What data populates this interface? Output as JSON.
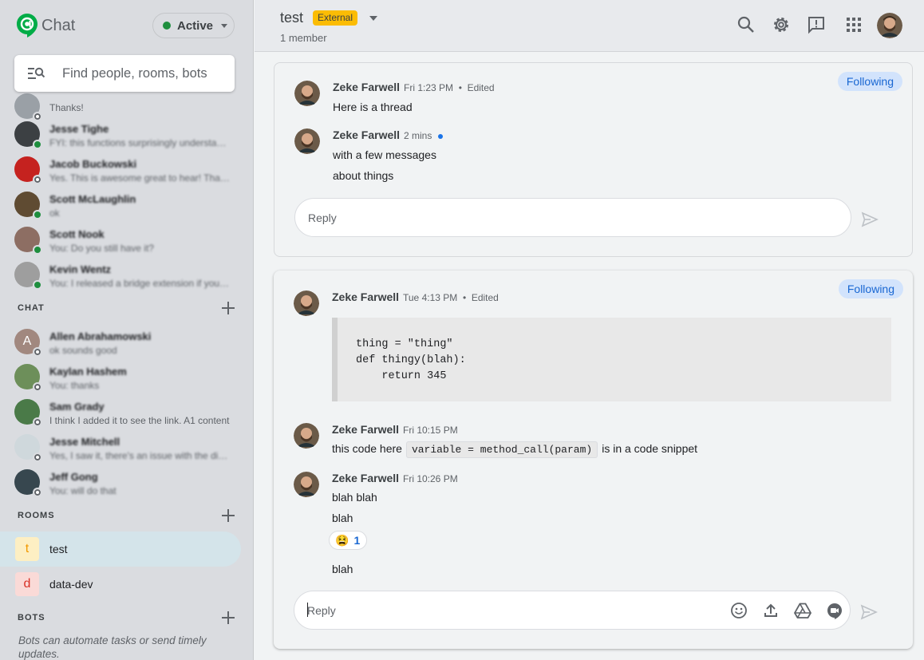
{
  "app": {
    "name": "Chat",
    "status": "Active"
  },
  "search": {
    "placeholder": "Find people, rooms, bots"
  },
  "dms": [
    {
      "name": "",
      "preview": "Thanks!",
      "online": false,
      "color": "#9aa0a6"
    },
    {
      "name": "Jesse Tighe",
      "preview": "FYI: this functions surprisingly understan...",
      "online": true,
      "color": "#3c4043"
    },
    {
      "name": "Jacob Buckowski",
      "preview": "Yes. This is awesome great to hear! Thank...",
      "online": false,
      "color": "#c5221f"
    },
    {
      "name": "Scott McLaughlin",
      "preview": "ok",
      "online": true,
      "color": "#5f4b32"
    },
    {
      "name": "Scott Nook",
      "preview": "You: Do you still have it?",
      "online": true,
      "color": "#8d6e63"
    },
    {
      "name": "Kevin Wentz",
      "preview": "You: I released a bridge extension if you wa...",
      "online": true,
      "color": "#9e9e9e"
    }
  ],
  "chat_section": {
    "title": "CHAT",
    "items": [
      {
        "name": "Allen Abrahamowski",
        "preview": "ok sounds good",
        "initial": "A",
        "color": "#a1887f"
      },
      {
        "name": "Kaylan Hashem",
        "preview": "You: thanks",
        "initial": "",
        "color": "#6d8f5a"
      },
      {
        "name": "Sam Grady",
        "preview": "I think I added it to see the link. A1 content",
        "initial": "",
        "color": "#4a7a48"
      },
      {
        "name": "Jesse Mitchell",
        "preview": "Yes, I saw it, there's an issue with the displa...",
        "initial": "",
        "color": "#cfd8dc"
      },
      {
        "name": "Jeff Gong",
        "preview": "You: will do that",
        "initial": "",
        "color": "#37474f"
      }
    ]
  },
  "rooms_section": {
    "title": "ROOMS",
    "items": [
      {
        "initial": "t",
        "name": "test",
        "active": true,
        "badge_bg": "#fdefc3",
        "badge_fg": "#f29900"
      },
      {
        "initial": "d",
        "name": "data-dev",
        "active": false,
        "badge_bg": "#fadad7",
        "badge_fg": "#d93025"
      }
    ]
  },
  "bots_section": {
    "title": "BOTS",
    "description": "Bots can automate tasks or send timely updates."
  },
  "header": {
    "title": "test",
    "badge": "External",
    "members": "1 member",
    "icons": [
      "search-icon",
      "settings-icon",
      "feedback-icon",
      "apps-icon"
    ]
  },
  "threads": [
    {
      "following": "Following",
      "messages": [
        {
          "author": "Zeke Farwell",
          "time": "Fri 1:23 PM",
          "edited": "Edited",
          "lines": [
            "Here is a thread"
          ]
        },
        {
          "author": "Zeke Farwell",
          "time": "2 mins",
          "edited": "",
          "lines": [
            "with a few messages",
            "about things"
          ]
        }
      ],
      "reply_placeholder": "Reply"
    },
    {
      "following": "Following",
      "messages": [
        {
          "author": "Zeke Farwell",
          "time": "Tue 4:13 PM",
          "edited": "Edited",
          "code": "thing = \"thing\"\ndef thingy(blah):\n    return 345"
        },
        {
          "author": "Zeke Farwell",
          "time": "Fri 10:15 PM",
          "edited": "",
          "text_before": "this code here",
          "inline_code": "variable = method_call(param)",
          "text_after": "is in a code snippet"
        },
        {
          "author": "Zeke Farwell",
          "time": "Fri 10:26 PM",
          "edited": "",
          "lines": [
            "blah blah",
            "blah"
          ],
          "reaction": {
            "emoji": "😫",
            "count": "1"
          },
          "after": "blah"
        }
      ],
      "reply_placeholder": "Reply"
    }
  ],
  "colors": {
    "accent": "#1a73e8",
    "online": "#1e8e3e",
    "external_badge": "#fbbc04"
  }
}
